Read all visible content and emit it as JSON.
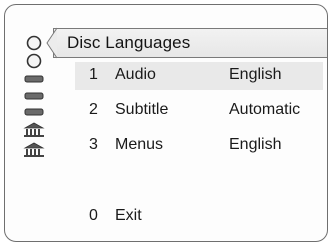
{
  "menu": {
    "title": "Disc Languages",
    "items": [
      {
        "number": "1",
        "label": "Audio",
        "value": "English",
        "selected": true
      },
      {
        "number": "2",
        "label": "Subtitle",
        "value": "Automatic",
        "selected": false
      },
      {
        "number": "3",
        "label": "Menus",
        "value": "English",
        "selected": false
      }
    ],
    "exit": {
      "number": "0",
      "label": "Exit"
    }
  },
  "sidebar": {
    "icons": [
      "disc-icon",
      "disc-icon",
      "tape-icon",
      "tape-icon",
      "tape-icon",
      "building-icon",
      "building-icon"
    ]
  },
  "colors": {
    "border": "#6f6f6f",
    "highlight": "#e9e9e9",
    "text": "#1a1a1a"
  }
}
